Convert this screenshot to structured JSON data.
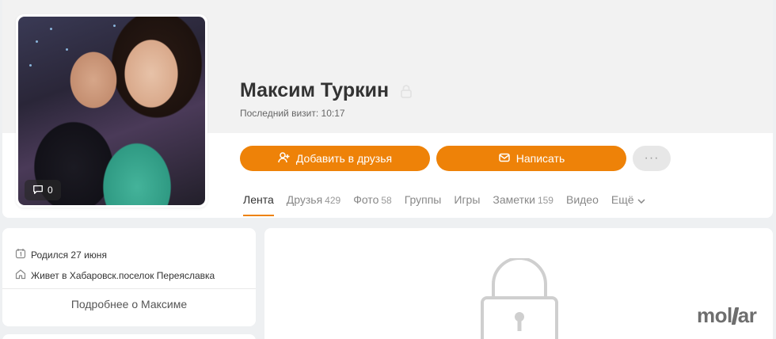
{
  "profile": {
    "name": "Максим Туркин",
    "last_visit": "Последний визит: 10:17",
    "photo_comments": "0"
  },
  "actions": {
    "add_friend": "Добавить в друзья",
    "write": "Написать",
    "more": "···"
  },
  "tabs": [
    {
      "label": "Лента",
      "count": ""
    },
    {
      "label": "Друзья",
      "count": "429"
    },
    {
      "label": "Фото",
      "count": "58"
    },
    {
      "label": "Группы",
      "count": ""
    },
    {
      "label": "Игры",
      "count": ""
    },
    {
      "label": "Заметки",
      "count": "159"
    },
    {
      "label": "Видео",
      "count": ""
    },
    {
      "label": "Ещё",
      "count": ""
    }
  ],
  "info": {
    "birthday": "Родился 27 июня",
    "city": "Живет в Хабаровск.поселок Переяславка",
    "more_link": "Подробнее о Максиме"
  },
  "watermark": {
    "text_before": "mol",
    "text_after": "ar"
  },
  "colors": {
    "accent": "#ee8208",
    "background": "#eef0f2"
  },
  "icons": {
    "photo_comments": "comment-icon",
    "private": "lock-icon",
    "add_friend": "add-user-icon",
    "write": "mail-icon",
    "more_tabs": "chevron-down-icon",
    "birthday": "calendar-icon",
    "city": "home-icon",
    "locked_content": "lock-icon"
  }
}
